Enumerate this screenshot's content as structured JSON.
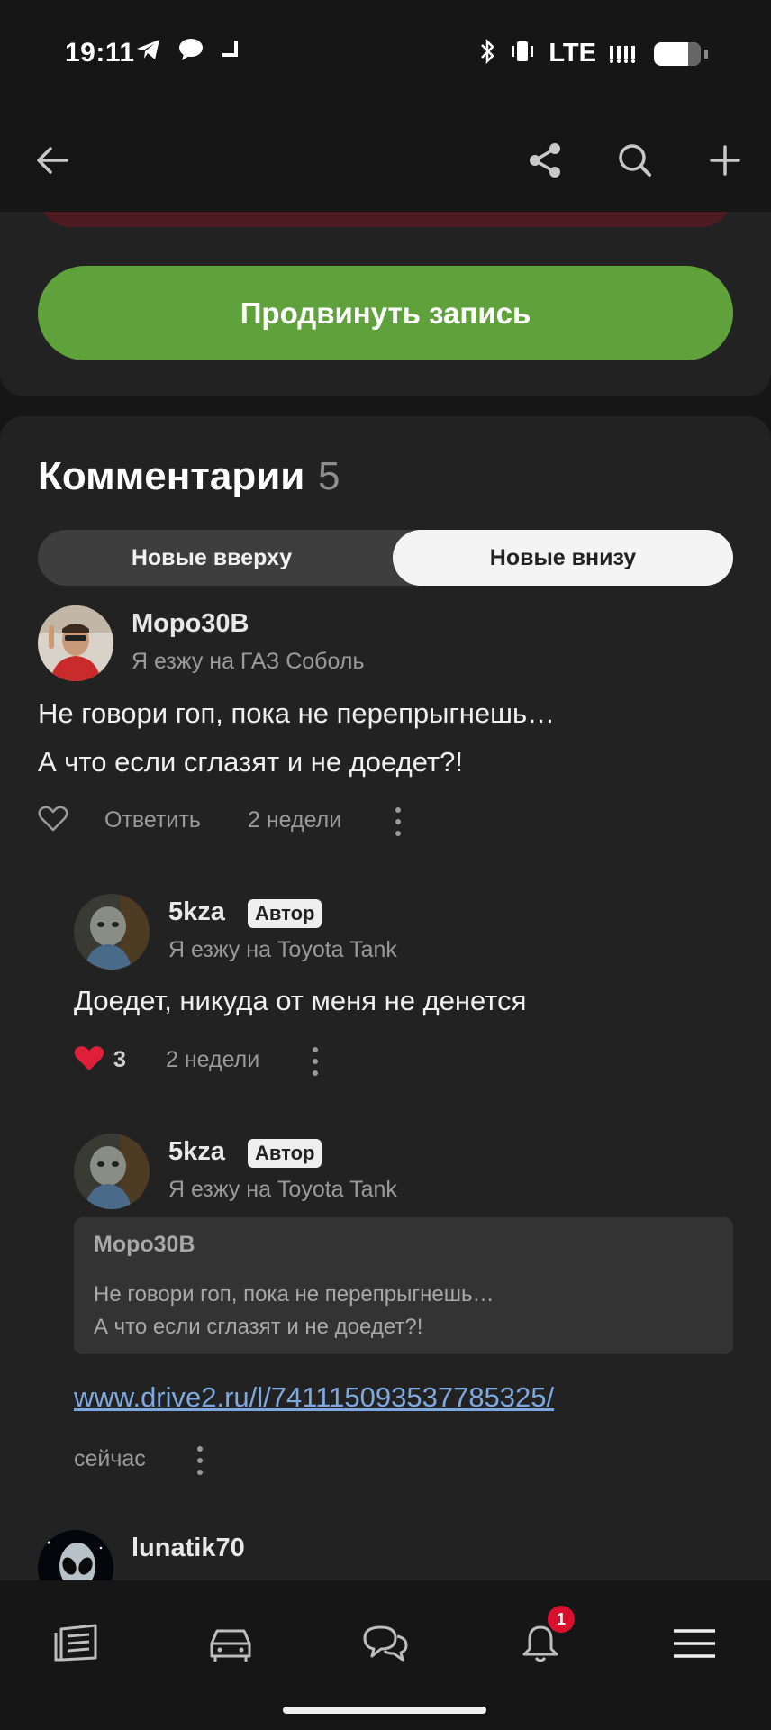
{
  "status_bar": {
    "time": "19:11",
    "network": "LTE",
    "left_icons": [
      "telegram-icon",
      "chat-bubble-icon",
      "notch-icon"
    ],
    "right_icons": [
      "bluetooth-icon",
      "vibrate-icon",
      "signal-icon",
      "battery-icon"
    ]
  },
  "app_bar": {
    "icons": [
      "back-arrow-icon",
      "share-icon",
      "search-icon",
      "plus-icon"
    ]
  },
  "promote": {
    "label": "Продвинуть запись"
  },
  "comments": {
    "title": "Комментарии",
    "count": "5",
    "sort": {
      "newest_top": "Новые вверху",
      "newest_bottom": "Новые внизу",
      "selected": "Новые внизу"
    },
    "items": [
      {
        "author": "Моро30В",
        "car": "Я езжу на ГАЗ Соболь",
        "text_line1": "Не говори гоп, пока не перепрыгнешь…",
        "text_line2": "А что если сглазят и не доедет?!",
        "reply": "Ответить",
        "time": "2 недели",
        "liked": false
      },
      {
        "author": "5kza",
        "badge": "Автор",
        "car": "Я езжу на Toyota Tank",
        "text": "Доедет, никуда от меня не денется",
        "likes": "3",
        "time": "2 недели",
        "liked": true
      },
      {
        "author": "5kza",
        "badge": "Автор",
        "car": "Я езжу на Toyota Tank",
        "quote": {
          "author": "Моро30В",
          "line1": "Не говори гоп, пока не перепрыгнешь…",
          "line2": "А что если сглазят и не доедет?!"
        },
        "link": "www.drive2.ru/l/741115093537785325/",
        "time": "сейчас"
      },
      {
        "author": "lunatik70"
      }
    ]
  },
  "bottom_nav": {
    "items": [
      "feed-icon",
      "car-icon",
      "messages-icon",
      "notifications-icon",
      "menu-icon"
    ],
    "notification_count": "1"
  },
  "colors": {
    "background": "#161616",
    "card": "#222222",
    "promote_green": "#5fa23b",
    "like_red": "#e0203a",
    "link_blue": "#7ea8e0",
    "badge_red": "#d8102e"
  }
}
